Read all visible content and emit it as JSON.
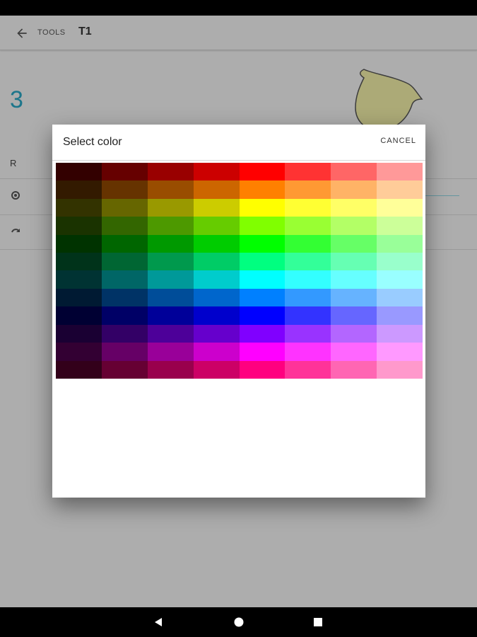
{
  "app_bar": {
    "section_label": "TOOLS",
    "title": "T1"
  },
  "main": {
    "value_display": "3",
    "row_label": "R",
    "shape_color": "#f3f0a8"
  },
  "dialog": {
    "title": "Select color",
    "cancel_label": "CANCEL",
    "palette": [
      [
        "#330000",
        "#660000",
        "#990000",
        "#cc0000",
        "#ff0000",
        "#ff3333",
        "#ff6666",
        "#ff9999"
      ],
      [
        "#331a00",
        "#663300",
        "#994d00",
        "#cc6600",
        "#ff8000",
        "#ff9933",
        "#ffb366",
        "#ffcc99"
      ],
      [
        "#333300",
        "#666600",
        "#999900",
        "#cccc00",
        "#ffff00",
        "#ffff33",
        "#ffff66",
        "#ffff99"
      ],
      [
        "#1a3300",
        "#336600",
        "#4d9900",
        "#66cc00",
        "#80ff00",
        "#99ff33",
        "#b3ff66",
        "#ccff99"
      ],
      [
        "#003300",
        "#006600",
        "#009900",
        "#00cc00",
        "#00ff00",
        "#33ff33",
        "#66ff66",
        "#99ff99"
      ],
      [
        "#00331a",
        "#006633",
        "#00994d",
        "#00cc66",
        "#00ff80",
        "#33ff99",
        "#66ffb3",
        "#99ffcc"
      ],
      [
        "#003333",
        "#006666",
        "#009999",
        "#00cccc",
        "#00ffff",
        "#33ffff",
        "#66ffff",
        "#99ffff"
      ],
      [
        "#001a33",
        "#003366",
        "#004d99",
        "#0066cc",
        "#0080ff",
        "#3399ff",
        "#66b3ff",
        "#99ccff"
      ],
      [
        "#000033",
        "#000066",
        "#000099",
        "#0000cc",
        "#0000ff",
        "#3333ff",
        "#6666ff",
        "#9999ff"
      ],
      [
        "#1a0033",
        "#330066",
        "#4d0099",
        "#6600cc",
        "#8000ff",
        "#9933ff",
        "#b366ff",
        "#cc99ff"
      ],
      [
        "#330033",
        "#660066",
        "#990099",
        "#cc00cc",
        "#ff00ff",
        "#ff33ff",
        "#ff66ff",
        "#ff99ff"
      ],
      [
        "#33001a",
        "#660033",
        "#99004d",
        "#cc0066",
        "#ff0080",
        "#ff3399",
        "#ff66b3",
        "#ff99cc"
      ]
    ]
  },
  "colors": {
    "accent": "#2aa6c4",
    "scrim": "rgba(0,0,0,0.29)"
  }
}
